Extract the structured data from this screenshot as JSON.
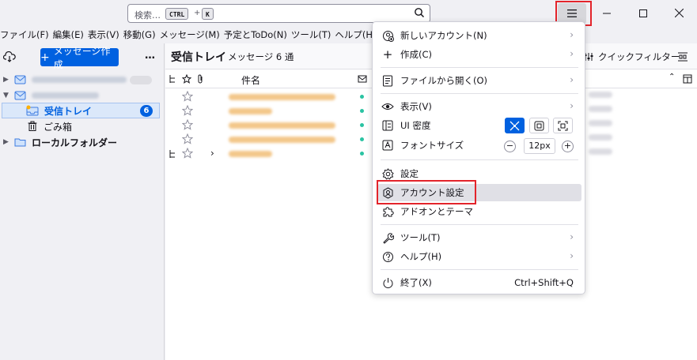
{
  "search": {
    "placeholder": "検索…",
    "key1": "CTRL",
    "plus": "+",
    "key2": "K"
  },
  "menubar": [
    "ファイル(F)",
    "編集(E)",
    "表示(V)",
    "移動(G)",
    "メッセージ(M)",
    "予定とToDo(N)",
    "ツール(T)",
    "ヘルプ(H)"
  ],
  "folders": {
    "new_message": "メッセージ作成",
    "more": "…",
    "inbox": "受信トレイ",
    "inbox_unread": "6",
    "trash": "ごみ箱",
    "local": "ローカルフォルダー"
  },
  "thread": {
    "title": "受信トレイ",
    "count": "メッセージ 6 通",
    "quick_filter": "クイックフィルター",
    "col_subject": "件名"
  },
  "appmenu": {
    "new_account": "新しいアカウント(N)",
    "create": "作成(C)",
    "open_file": "ファイルから開く(O)",
    "view": "表示(V)",
    "ui_density": "UI 密度",
    "font_size": "フォントサイズ",
    "font_size_value": "12px",
    "font_minus": "−",
    "font_plus": "+",
    "settings": "設定",
    "account_settings": "アカウント設定",
    "addons": "アドオンとテーマ",
    "tools": "ツール(T)",
    "help": "ヘルプ(H)",
    "quit": "終了(X)",
    "quit_shortcut": "Ctrl+Shift+Q"
  },
  "colors": {
    "accent": "#0061e0",
    "highlight_box": "#e3242b"
  }
}
